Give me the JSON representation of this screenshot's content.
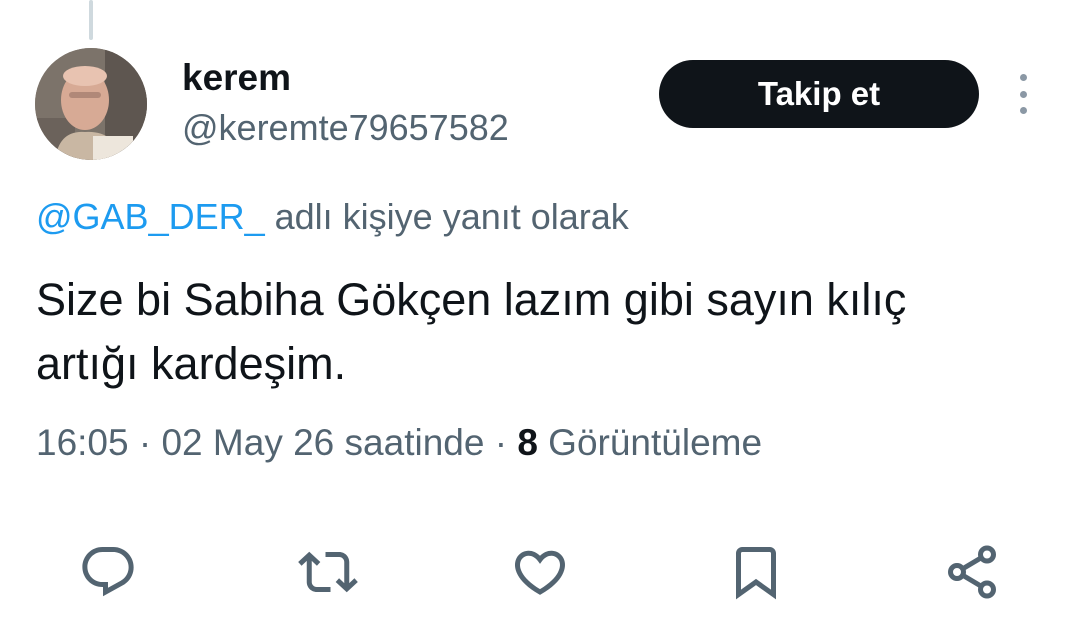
{
  "user": {
    "display_name": "kerem",
    "handle": "@keremte79657582",
    "avatar": "profile-photo"
  },
  "follow_button": {
    "label": "Takip et"
  },
  "more_menu": {
    "icon": "more-vertical-icon"
  },
  "reply_context": {
    "mention": "@GAB_DER_",
    "suffix": " adlı kişiye yanıt olarak"
  },
  "tweet": {
    "line1": "Size bi Sabiha Gökçen lazım gibi sayın kılıç",
    "line2": "artığı kardeşim."
  },
  "meta": {
    "time": "16:05",
    "separator": " · ",
    "date": "02 May 26 saatinde",
    "separator2": " · ",
    "views_count": "8",
    "views_label": " Görüntüleme"
  },
  "actions": [
    {
      "icon": "reply-icon"
    },
    {
      "icon": "retweet-icon"
    },
    {
      "icon": "like-icon"
    },
    {
      "icon": "bookmark-icon"
    },
    {
      "icon": "share-icon"
    }
  ],
  "colors": {
    "text_primary": "#0f1419",
    "text_secondary": "#536471",
    "link": "#1d9bf0",
    "button_bg": "#0f1419",
    "button_text": "#ffffff",
    "icon": "#536471"
  }
}
